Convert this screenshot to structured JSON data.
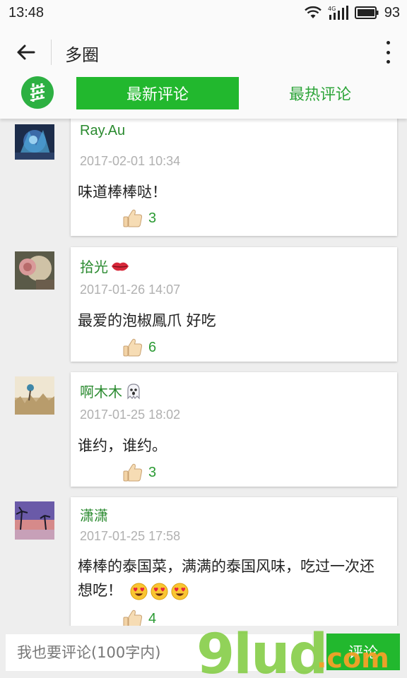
{
  "status": {
    "time": "13:48",
    "network": "4G",
    "battery": "93"
  },
  "appbar": {
    "title": "多圈"
  },
  "tabs": {
    "latest": "最新评论",
    "hottest": "最热评论"
  },
  "comments": [
    {
      "name": "Ray.Au",
      "time": "2017-02-01 10:34",
      "text": "味道棒棒哒！",
      "likes": "3"
    },
    {
      "name": "拾光",
      "time": "2017-01-26 14:07",
      "text": "最爱的泡椒鳳爪 好吃",
      "likes": "6"
    },
    {
      "name": "啊木木",
      "time": "2017-01-25 18:02",
      "text": "谁约，谁约。",
      "likes": "3"
    },
    {
      "name": "潇潇",
      "time": "2017-01-25 17:58",
      "text": "棒棒的泰国菜，满满的泰国风味，吃过一次还想吃！",
      "likes": "4"
    }
  ],
  "input": {
    "placeholder": "我也要评论(100字内)",
    "submit": "评论"
  },
  "watermark": {
    "main": "9lud",
    "suffix": ".com"
  },
  "colors": {
    "accent": "#22b82e",
    "name_green": "#2a8a2f",
    "time_gray": "#b0b0b0"
  }
}
